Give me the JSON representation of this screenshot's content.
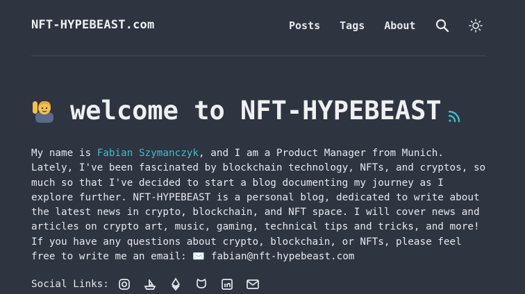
{
  "site": {
    "brand": "NFT-HYPEBEAST.com"
  },
  "nav": {
    "items": [
      "Posts",
      "Tags",
      "About"
    ],
    "icons": [
      "search-icon",
      "sun-icon"
    ]
  },
  "hero": {
    "title": "welcome to NFT-HYPEBEAST",
    "emoji": "waving-person",
    "rss_icon": "rss-icon"
  },
  "bio": {
    "intro_prefix": "My name is ",
    "author_link": "Fabian Szymanczyk",
    "intro_suffix": ", and I am a Product Manager from Munich. Lately, I've been fascinated by blockchain technology, NFTs, and cryptos, so much so that I've decided to start a blog documenting my journey as I explore further. NFT-HYPEBEAST is a personal blog, dedicated to write about the latest news in crypto, blockchain, and NFT space. I will cover news and articles on crypto art, music, gaming, technical tips and tricks, and more! If you have any questions about crypto, blockchain, or NFTs, please feel free to write me an email: ",
    "email_icon": "✉️",
    "email": "fabian@nft-hypebeast.com"
  },
  "social": {
    "label": "Social Links:",
    "icons": [
      "instagram-icon",
      "opensea-icon",
      "ethereum-icon",
      "github-icon",
      "linkedin-icon",
      "mail-icon"
    ]
  },
  "colors": {
    "background": "#2f3441",
    "accent": "#38c0d0",
    "text": "#e6e8ec"
  }
}
